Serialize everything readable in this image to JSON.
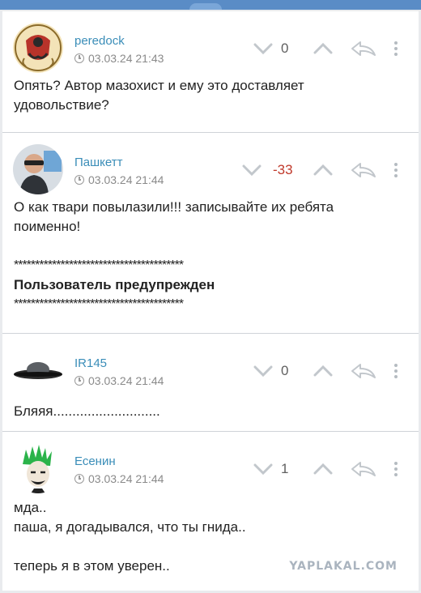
{
  "comments": [
    {
      "username": "peredock",
      "timestamp": "03.03.24 21:43",
      "score": "0",
      "body": [
        "Опять? Автор мазохист и ему это доставляет",
        "удовольствие?"
      ]
    },
    {
      "username": "Пашкетт",
      "timestamp": "03.03.24 21:44",
      "score": "-33",
      "body": [
        "О как твари повылазили!!! записывайте их ребята",
        "поименно!"
      ],
      "stars_top": "****************************************",
      "warning": "Пользователь предупрежден",
      "stars_bottom": "****************************************"
    },
    {
      "username": "IR145",
      "timestamp": "03.03.24 21:44",
      "score": "0",
      "body": [
        "Бляяя............................"
      ]
    },
    {
      "username": "Есенин",
      "timestamp": "03.03.24 21:44",
      "score": "1",
      "body": [
        "мда..",
        "паша, я догадывался, что ты гнида..",
        "",
        "теперь я в этом уверен.."
      ]
    }
  ],
  "watermark": "YAPLAKAL.COM",
  "colors": {
    "accent": "#3a8db8",
    "negative": "#c0392b",
    "topbar": "#5a8cc6"
  }
}
